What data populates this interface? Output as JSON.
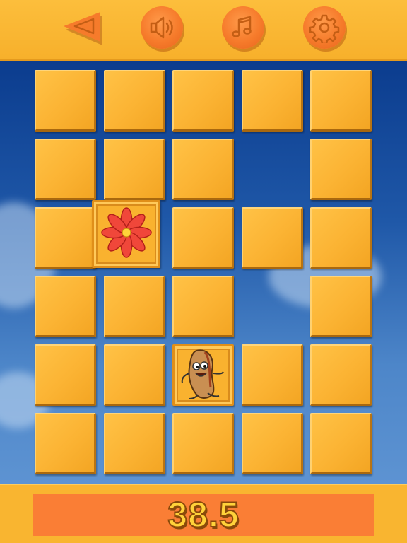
{
  "toolbar": {
    "back_icon": "back-triangle-icon",
    "sound_icon": "speaker-icon",
    "music_icon": "music-note-icon",
    "settings_icon": "gear-icon",
    "button_color": "#f67b2b",
    "bar_color": "#f9b530"
  },
  "board": {
    "columns": 5,
    "rows": 6,
    "cells": [
      [
        "tile",
        "tile",
        "tile",
        "tile",
        "tile"
      ],
      [
        "tile",
        "tile",
        "tile",
        "empty",
        "tile"
      ],
      [
        "tile",
        "flower",
        "tile",
        "tile",
        "tile"
      ],
      [
        "tile",
        "tile",
        "tile",
        "empty",
        "tile"
      ],
      [
        "tile",
        "tile",
        "bean",
        "tile",
        "tile"
      ],
      [
        "tile",
        "tile",
        "tile",
        "tile",
        "tile"
      ]
    ],
    "card_icons": {
      "flower": "red-flower-icon",
      "bean": "bean-character-icon"
    },
    "tile_color": "#fbb333",
    "background_color": "#1f58a8"
  },
  "footer": {
    "timer": "38.5",
    "timer_bar_color": "#fa7e35",
    "timer_text_color": "#ffd23a"
  }
}
